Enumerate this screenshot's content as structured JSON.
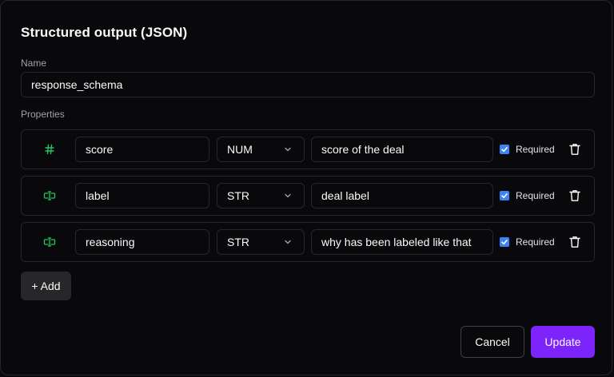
{
  "dialog": {
    "title": "Structured output (JSON)"
  },
  "name_field": {
    "label": "Name",
    "value": "response_schema"
  },
  "properties": {
    "label": "Properties",
    "items": [
      {
        "icon": "hash-icon",
        "name": "score",
        "type": "NUM",
        "description": "score of the deal",
        "required_label": "Required",
        "required": true
      },
      {
        "icon": "text-cursor-icon",
        "name": "label",
        "type": "STR",
        "description": "deal label",
        "required_label": "Required",
        "required": true
      },
      {
        "icon": "text-cursor-icon",
        "name": "reasoning",
        "type": "STR",
        "description": "why has been labeled like that",
        "required_label": "Required",
        "required": true
      }
    ]
  },
  "actions": {
    "add_label": "+ Add",
    "cancel_label": "Cancel",
    "update_label": "Update"
  },
  "colors": {
    "background": "#09090b",
    "border": "#27272a",
    "accent": "#7c24f9",
    "icon": "#22c55e",
    "checkbox": "#3b82f6"
  }
}
